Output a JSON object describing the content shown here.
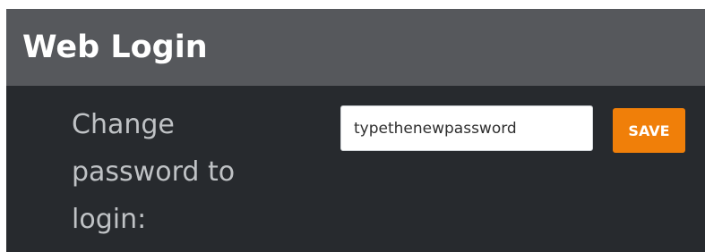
{
  "header": {
    "title": "Web Login"
  },
  "form": {
    "label": "Change password to login:",
    "password_input": {
      "value": "typethenewpassword",
      "placeholder": ""
    },
    "save_label": "SAVE"
  },
  "colors": {
    "header_bg": "#56585c",
    "panel_bg": "#272a2e",
    "accent": "#f07f09",
    "label_text": "#bfc2c5"
  }
}
